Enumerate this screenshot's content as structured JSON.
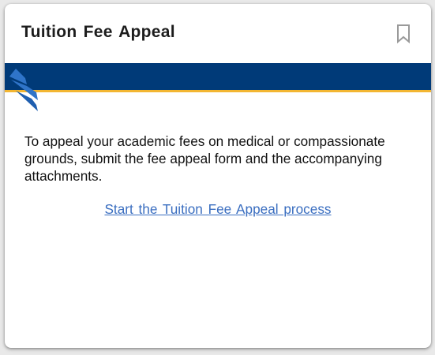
{
  "card": {
    "title": "Tuition Fee Appeal",
    "bookmark_icon": "bookmark-outline-icon",
    "banner": {
      "color": "#003a78",
      "accent_color": "#f3b632",
      "logo_icon": "university-logo-icon"
    },
    "description": "To appeal your academic fees on medical or compassionate grounds, submit the fee appeal form and the accompanying attachments.",
    "link_label": "Start the Tuition Fee Appeal process",
    "link_color": "#3a6ec0"
  }
}
